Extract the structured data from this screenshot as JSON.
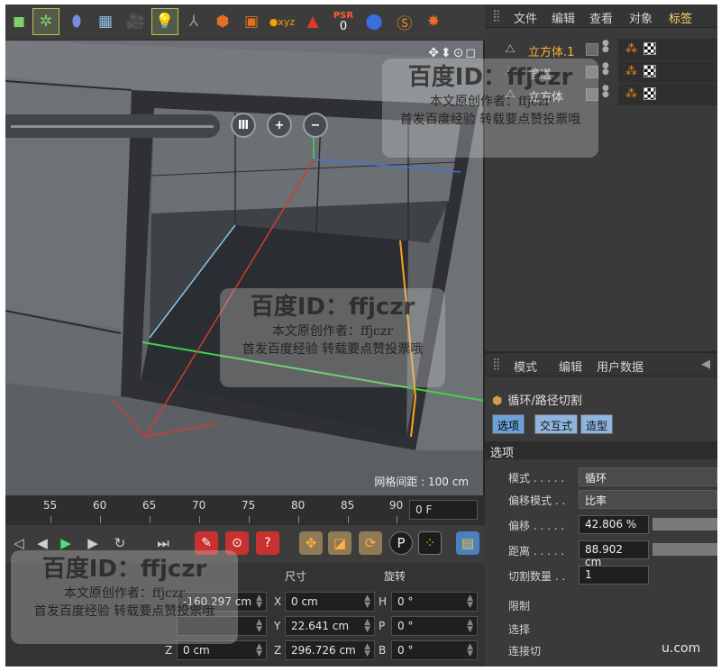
{
  "toolbar": {
    "icons": [
      "cube-primitive-icon",
      "gear-deformer-icon",
      "capsule-icon",
      "floor-grid-icon",
      "camera-icon",
      "light-icon",
      "bones-icon",
      "render-icon",
      "render-settings-icon",
      "xyz-axis-icon",
      "triangle-warn-icon",
      "psr-icon",
      "sphere-icon",
      "snap-icon",
      "burst-icon"
    ],
    "psr_label": "PSR",
    "psr_value": "0"
  },
  "viewport": {
    "nav_icons": "✥⬍⊙◻",
    "grid_spacing": "网格间距 : 100 cm",
    "buttons": [
      "Ⅲ",
      "+",
      "−"
    ]
  },
  "timeline": {
    "ticks": [
      "55",
      "60",
      "65",
      "70",
      "75",
      "80",
      "85",
      "90"
    ],
    "frame_field": "0 F"
  },
  "coords": {
    "headers": [
      "尺寸",
      "旋转"
    ],
    "rows": [
      {
        "pos_axis": "",
        "pos_val": "-160.297 cm",
        "size_axis": "X",
        "size_val": "0 cm",
        "rot_axis": "H",
        "rot_val": "0 °"
      },
      {
        "pos_axis": "",
        "pos_val": "",
        "size_axis": "Y",
        "size_val": "22.641 cm",
        "rot_axis": "P",
        "rot_val": "0 °"
      },
      {
        "pos_axis": "Z",
        "pos_val": "0 cm",
        "size_axis": "Z",
        "size_val": "296.726 cm",
        "rot_axis": "B",
        "rot_val": "0 °"
      }
    ]
  },
  "objects": {
    "menu": [
      "文件",
      "编辑",
      "查看",
      "对象",
      "标签"
    ],
    "items": [
      {
        "name": "立方体.1",
        "selected": true
      },
      {
        "name": "管道",
        "selected": false
      },
      {
        "name": "立方体",
        "selected": false
      }
    ]
  },
  "attributes": {
    "menu": [
      "模式",
      "编辑",
      "用户数据"
    ],
    "tool_name": "循环/路径切割",
    "tabs": [
      "选项",
      "交互式",
      "造型"
    ],
    "section": "选项",
    "params": [
      {
        "label": "模式 . . . . .",
        "value": "循环"
      },
      {
        "label": "偏移模式 . .",
        "value": "比率"
      },
      {
        "label": "偏移 . . . . .",
        "value": "42.806 %"
      },
      {
        "label": "距离 . . . . .",
        "value": "88.902 cm"
      },
      {
        "label": "切割数量 . .",
        "value": "1"
      }
    ],
    "extra_labels": [
      "限制",
      "选择",
      "连接切"
    ]
  },
  "watermark": {
    "title": "百度ID：ffjczr",
    "line1": "本文原创作者：ffjczr",
    "line2": "首发百度经验 转载要点赞投票哦",
    "corner_fragment": "u.com"
  },
  "colors": {
    "selected_object": "#ffb33a",
    "active_menu": "#ffd56a",
    "tab_active": "#6ba0d8",
    "record_red": "#c8312f",
    "axis_red": "#d23b2e",
    "axis_green": "#3fd34a",
    "axis_blue": "#4a6fe0",
    "edge_orange": "#ffa21f"
  }
}
